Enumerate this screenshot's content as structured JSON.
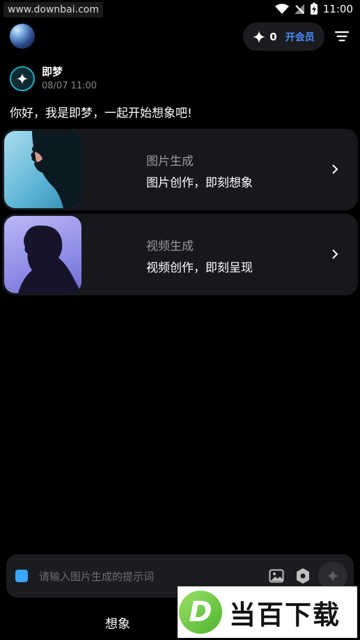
{
  "status_bar": {
    "watermark": "www.downbai.com",
    "time": "11:00",
    "icons": [
      "wifi-icon",
      "signal-off-icon",
      "battery-charging-icon"
    ]
  },
  "header": {
    "credits": "0",
    "vip_label": "开会员",
    "icons": [
      "sparkle-icon",
      "filter-menu-icon"
    ]
  },
  "message": {
    "bot_name": "即梦",
    "timestamp": "08/07 11:00",
    "greeting": "你好，我是即梦，一起开始想象吧!"
  },
  "cards": [
    {
      "title": "图片生成",
      "subtitle": "图片创作，即刻想象"
    },
    {
      "title": "视频生成",
      "subtitle": "视频创作，即刻呈现"
    }
  ],
  "input": {
    "placeholder": "请输入图片生成的提示词",
    "value": ""
  },
  "bottom_tab": {
    "label": "想象"
  },
  "watermark_logo": {
    "letter": "D",
    "text": "当百下载"
  },
  "colors": {
    "background": "#000000",
    "card": "#17181c",
    "accent_blue": "#4a8cff",
    "mode_square": "#3aa6ff",
    "bot_ring": "#1fb2c9"
  }
}
